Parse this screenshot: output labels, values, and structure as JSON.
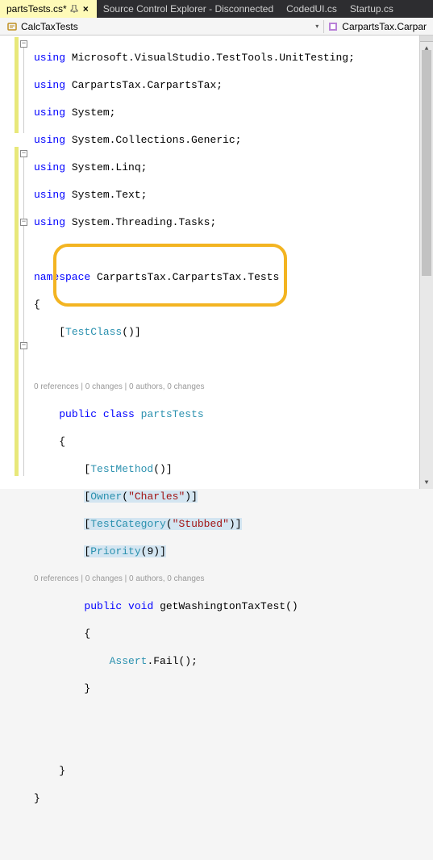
{
  "tabs": [
    {
      "label": "partsTests.cs*",
      "active": true,
      "pinned": true,
      "closeable": true
    },
    {
      "label": "Source Control Explorer - Disconnected",
      "active": false
    },
    {
      "label": "CodedUI.cs",
      "active": false
    },
    {
      "label": "Startup.cs",
      "active": false
    }
  ],
  "nav": {
    "class_label": "CalcTaxTests",
    "member_label": "CarpartsTax.Carpar"
  },
  "codelens": {
    "class": "0 references | 0 changes | 0 authors, 0 changes",
    "method": "0 references | 0 changes | 0 authors, 0 changes"
  },
  "code": {
    "using1_ns": "Microsoft.VisualStudio.TestTools.UnitTesting",
    "using2_ns": "CarpartsTax.CarpartsTax",
    "using3_ns": "System",
    "using4_ns": "System.Collections.Generic",
    "using5_ns": "System.Linq",
    "using6_ns": "System.Text",
    "using7_ns": "System.Threading.Tasks",
    "namespace": "CarpartsTax.CarpartsTax.Tests",
    "attr_testclass": "TestClass",
    "class_name": "partsTests",
    "attr_testmethod": "TestMethod",
    "attr_owner": "Owner",
    "owner_val": "\"Charles\"",
    "attr_testcategory": "TestCategory",
    "testcategory_val": "\"Stubbed\"",
    "attr_priority": "Priority",
    "priority_val": "9",
    "method_name": "getWashingtonTaxTest",
    "assert_class": "Assert",
    "assert_method": "Fail",
    "kw_using": "using",
    "kw_namespace": "namespace",
    "kw_public": "public",
    "kw_class": "class",
    "kw_void": "void"
  }
}
